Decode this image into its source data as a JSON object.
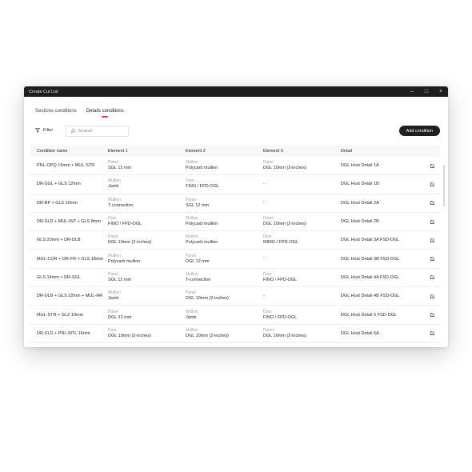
{
  "window": {
    "title": "Create Cut List",
    "controls": [
      "–",
      "□",
      "×"
    ]
  },
  "tabs": [
    {
      "label": "Sections conditions",
      "active": false
    },
    {
      "label": "Details conditions",
      "active": true
    }
  ],
  "accent_color": "#e8335a",
  "toolbar": {
    "filter_label": "Filter",
    "search_placeholder": "Search",
    "add_button_label": "Add condition"
  },
  "table": {
    "headers": [
      "Condition name",
      "Element 1",
      "Element 2",
      "Element 3",
      "Detail"
    ],
    "rows": [
      {
        "name": "PNL-OPQ 15mm + MUL-STR",
        "e1_type": "Panel",
        "e1_value": "SGL 12 mm",
        "e2_type": "Mullion",
        "e2_value": "Polycarb mullion",
        "e3_type": "Panel",
        "e3_value": "DGL 10mm (2-inches)",
        "detail": "DGL Host Detail 1A"
      },
      {
        "name": "DR-SGL + GLS 12mm",
        "e1_type": "Mullion",
        "e1_value": "Jamb",
        "e2_type": "Door",
        "e2_value": "FINO / FPD-OGL",
        "e3_type": "",
        "e3_value": "-",
        "detail": "DGL Host Detail 1B"
      },
      {
        "name": "DR-BP + GLZ 10mm",
        "e1_type": "Mullion",
        "e1_value": "T-connection",
        "e2_type": "Panel",
        "e2_value": "SGL 12 mm",
        "e3_type": "",
        "e3_value": "-",
        "detail": "DGL Host Detail 2A"
      },
      {
        "name": "DR-SLD + MUL-INT + GLS 8mm",
        "e1_type": "Door",
        "e1_value": "FINO / FPD-OGL",
        "e2_type": "Mullion",
        "e2_value": "Polycarb mullion",
        "e3_type": "Panel",
        "e3_value": "DGL 10mm (2-inches)",
        "detail": "DGL Host Detail 2B"
      },
      {
        "name": "GLS 20mm + DR-DLB",
        "e1_type": "Panel",
        "e1_value": "DGL 10mm (2-inches)",
        "e2_type": "Mullion",
        "e2_value": "Polycarb mullion",
        "e3_type": "Door",
        "e3_value": "MIMO / FPD-OGL",
        "detail": "DGL Host Detail 3A FSD-DGL"
      },
      {
        "name": "MUL-COR + DR-FR + GLS 18mm",
        "e1_type": "Mullion",
        "e1_value": "Polycarb mullion",
        "e2_type": "Panel",
        "e2_value": "DGL 12 mm",
        "e3_type": "",
        "e3_value": "-",
        "detail": "DGL Host Detail 3B FSD-DGL"
      },
      {
        "name": "GLS 14mm + DR-SGL",
        "e1_type": "Panel",
        "e1_value": "SGL 12 mm",
        "e2_type": "Mullion",
        "e2_value": "T-connection",
        "e3_type": "Door",
        "e3_value": "FINO / FPD-OGL",
        "detail": "DGL Host Detail 4A FSD-DGL"
      },
      {
        "name": "DR-DLB + GLS 22mm + MUL-HR",
        "e1_type": "Mullion",
        "e1_value": "Jamb",
        "e2_type": "Panel",
        "e2_value": "DGL 10mm (2-inches)",
        "e3_type": "",
        "e3_value": "-",
        "detail": "DGL Host Detail 4B FSD-DGL"
      },
      {
        "name": "MUL-STR + GLZ 10mm",
        "e1_type": "Panel",
        "e1_value": "DGL 12 mm",
        "e2_type": "Mullion",
        "e2_value": "Jamb",
        "e3_type": "Door",
        "e3_value": "FINO / FPD-OGL",
        "detail": "DGL Host Detail 5 FSD-DGL"
      },
      {
        "name": "DR-SLD + PNL-MTL 16mm",
        "e1_type": "Door",
        "e1_value": "DGL 10mm (2-inches)",
        "e2_type": "Mullion",
        "e2_value": "DGL 10mm (2-inches)",
        "e3_type": "Panel",
        "e3_value": "DGL 10mm (2-inches)",
        "detail": "DGL Host Detail 6A"
      }
    ]
  }
}
